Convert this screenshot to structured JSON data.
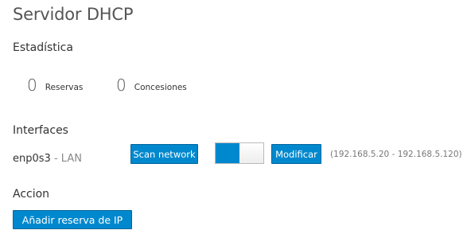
{
  "page": {
    "title": "Servidor DHCP"
  },
  "stats": {
    "heading": "Estadística",
    "reservations": {
      "count": "0",
      "label": "Reservas"
    },
    "leases": {
      "count": "0",
      "label": "Concesiones"
    }
  },
  "interfaces": {
    "heading": "Interfaces",
    "items": [
      {
        "name": "enp0s3",
        "separator": "-",
        "zone": "LAN",
        "scan_label": "Scan network",
        "enabled": true,
        "modify_label": "Modificar",
        "range": "(192.168.5.20 - 192.168.5.120)"
      }
    ]
  },
  "actions": {
    "heading": "Accion",
    "add_reservation_label": "Añadir reserva de IP"
  },
  "colors": {
    "accent": "#0088ce",
    "accent_border": "#00659c"
  }
}
